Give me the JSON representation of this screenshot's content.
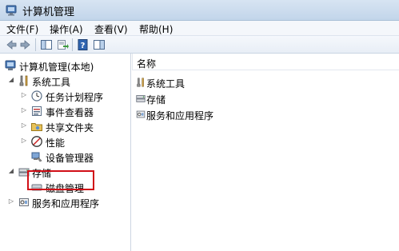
{
  "window": {
    "title": "计算机管理"
  },
  "menu": {
    "items": [
      {
        "label": "文件(F)"
      },
      {
        "label": "操作(A)"
      },
      {
        "label": "查看(V)"
      },
      {
        "label": "帮助(H)"
      }
    ]
  },
  "toolbar": {
    "buttons": [
      "back-icon",
      "forward-icon",
      "show-hide-tree-icon",
      "export-list-icon",
      "help-icon",
      "show-hide-action-pane-icon"
    ]
  },
  "tree": {
    "root": {
      "label": "计算机管理(本地)",
      "icon": "computer-management-icon"
    },
    "system_tools": {
      "label": "系统工具",
      "icon": "tools-icon",
      "expanded": true
    },
    "task_scheduler": {
      "label": "任务计划程序",
      "icon": "clock-icon"
    },
    "event_viewer": {
      "label": "事件查看器",
      "icon": "event-viewer-icon"
    },
    "shared_folders": {
      "label": "共享文件夹",
      "icon": "shared-folder-icon"
    },
    "performance": {
      "label": "性能",
      "icon": "performance-icon"
    },
    "device_manager": {
      "label": "设备管理器",
      "icon": "device-manager-icon"
    },
    "storage": {
      "label": "存储",
      "icon": "storage-icon",
      "expanded": true
    },
    "disk_management": {
      "label": "磁盘管理",
      "icon": "disk-icon",
      "highlighted": true
    },
    "services_apps": {
      "label": "服务和应用程序",
      "icon": "services-icon"
    }
  },
  "list": {
    "column_header": "名称",
    "items": [
      {
        "label": "系统工具",
        "icon": "tools-icon"
      },
      {
        "label": "存储",
        "icon": "storage-icon"
      },
      {
        "label": "服务和应用程序",
        "icon": "services-icon"
      }
    ]
  },
  "colors": {
    "highlight_border": "#d10f17",
    "title_bar": "#c2d5ea"
  }
}
